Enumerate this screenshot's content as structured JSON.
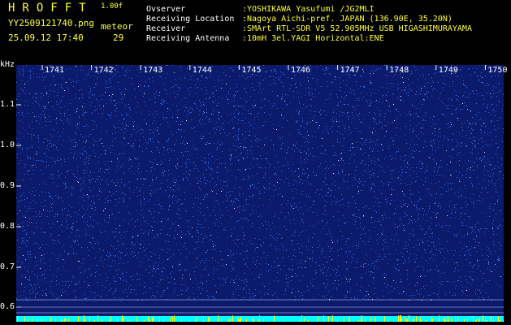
{
  "header": {
    "app_title": "HROFFT",
    "app_version": "1.00f",
    "file_name": "YY2509121740.png",
    "timestamp": "25.09.12 17:40",
    "meteor_label": "meteor",
    "meteor_count": "29"
  },
  "info": [
    {
      "key": "Ovserver",
      "value": ":YOSHIKAWA Yasufumi /JG2MLI"
    },
    {
      "key": "Receiving Location",
      "value": ":Nagoya Aichi-pref. JAPAN (136.90E, 35.20N)"
    },
    {
      "key": "Receiver",
      "value": ":SMArt RTL-SDR V5 52.905MHz USB HIGASHIMURAYAMA"
    },
    {
      "key": "Receiving Antenna",
      "value": ":10mH 3el.YAGI Horizontal:ENE"
    }
  ],
  "spectrogram": {
    "y_unit": "kHz",
    "y_ticks": [
      "1.1",
      "1.0",
      "0.9",
      "0.8",
      "0.7",
      "0.6"
    ],
    "x_ticks": [
      "1741",
      "1742",
      "1743",
      "1744",
      "1745",
      "1746",
      "1747",
      "1748",
      "1749",
      "1750"
    ],
    "colors": {
      "background": "#0b1a6a",
      "noise": "#3a7cff",
      "noise_bright": "#ffffff",
      "baseline": "#00ffff",
      "baseline_spikes": "#ffff00",
      "text_primary": "#ffff33",
      "text_secondary": "#ffffff"
    }
  }
}
